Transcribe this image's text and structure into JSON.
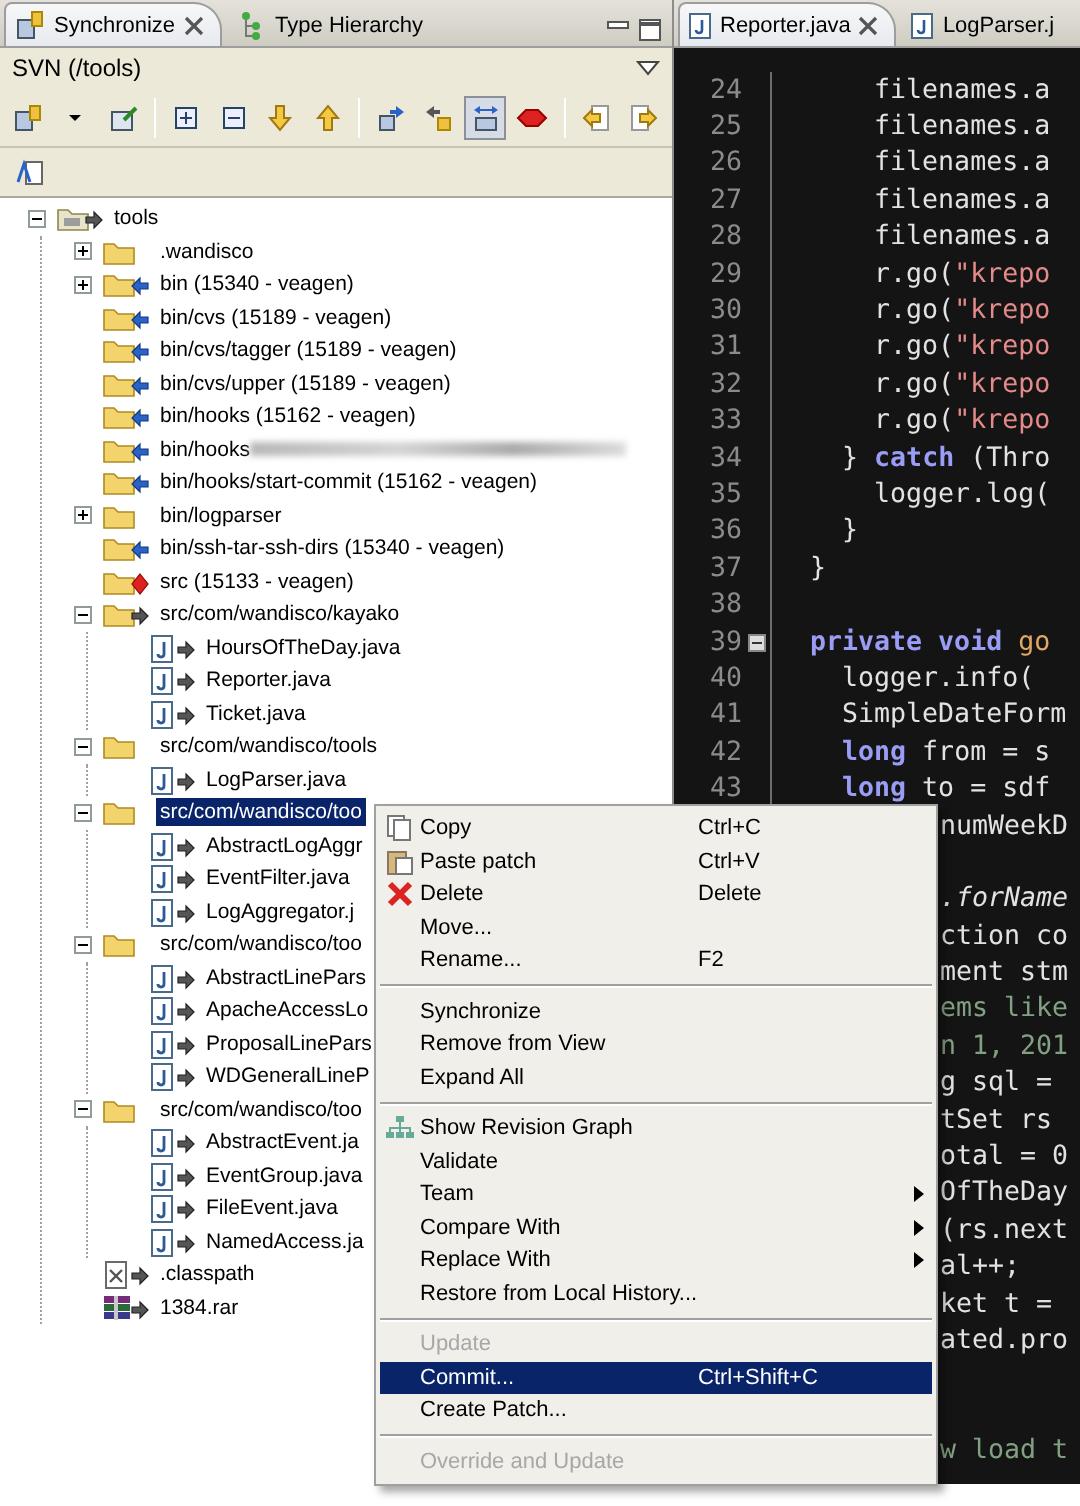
{
  "view_tabs": [
    {
      "label": "Synchronize",
      "selected": true
    },
    {
      "label": "Type Hierarchy",
      "selected": false
    }
  ],
  "view_title": "SVN (/tools)",
  "toolbar": [
    {
      "kind": "synchronize",
      "pressed": false
    },
    {
      "kind": "dropdown",
      "pressed": false
    },
    {
      "kind": "commit",
      "pressed": false
    },
    {
      "kind": "separator"
    },
    {
      "kind": "expand",
      "pressed": false
    },
    {
      "kind": "collapse",
      "pressed": false
    },
    {
      "kind": "next",
      "pressed": false
    },
    {
      "kind": "previous",
      "pressed": false
    },
    {
      "kind": "separator"
    },
    {
      "kind": "incoming",
      "pressed": false
    },
    {
      "kind": "outgoing",
      "pressed": false
    },
    {
      "kind": "both",
      "pressed": true
    },
    {
      "kind": "conflicts",
      "pressed": false
    },
    {
      "kind": "separator"
    },
    {
      "kind": "back",
      "pressed": false
    },
    {
      "kind": "forward",
      "pressed": false
    }
  ],
  "toolbar_2": [
    {
      "kind": "sort",
      "pressed": false
    }
  ],
  "tree": [
    {
      "label": "tools",
      "kind": "project",
      "incoming": false,
      "outgoing": true,
      "conflict": false,
      "selected": false,
      "expanded": true,
      "children": [
        {
          "label": ".wandisco",
          "kind": "folder",
          "incoming": false,
          "outgoing": false,
          "conflict": false,
          "selected": false,
          "expanded": false
        },
        {
          "label": "bin (15340 - veagen)",
          "kind": "folder",
          "incoming": true,
          "outgoing": false,
          "conflict": false,
          "selected": false,
          "expanded": false
        },
        {
          "label": "bin/cvs (15189 - veagen)",
          "kind": "folder",
          "incoming": true,
          "outgoing": false,
          "conflict": false,
          "selected": false
        },
        {
          "label": "bin/cvs/tagger (15189 - veagen)",
          "kind": "folder",
          "incoming": true,
          "outgoing": false,
          "conflict": false,
          "selected": false
        },
        {
          "label": "bin/cvs/upper (15189 - veagen)",
          "kind": "folder",
          "incoming": true,
          "outgoing": false,
          "conflict": false,
          "selected": false
        },
        {
          "label": "bin/hooks (15162 - veagen)",
          "kind": "folder",
          "incoming": true,
          "outgoing": false,
          "conflict": false,
          "selected": false
        },
        {
          "label": "bin/hooks",
          "kind": "folder",
          "incoming": true,
          "outgoing": false,
          "conflict": false,
          "selected": false,
          "redacted": true
        },
        {
          "label": "bin/hooks/start-commit (15162 - veagen)",
          "kind": "folder",
          "incoming": true,
          "outgoing": false,
          "conflict": false,
          "selected": false
        },
        {
          "label": "bin/logparser",
          "kind": "folder",
          "incoming": false,
          "outgoing": false,
          "conflict": false,
          "selected": false,
          "expanded": false
        },
        {
          "label": "bin/ssh-tar-ssh-dirs (15340 - veagen)",
          "kind": "folder",
          "incoming": true,
          "outgoing": false,
          "conflict": false,
          "selected": false
        },
        {
          "label": "src (15133 - veagen)",
          "kind": "folder",
          "incoming": false,
          "outgoing": false,
          "conflict": true,
          "selected": false
        },
        {
          "label": "src/com/wandisco/kayako",
          "kind": "folder",
          "incoming": false,
          "outgoing": true,
          "conflict": false,
          "selected": false,
          "expanded": true,
          "children": [
            {
              "label": "HoursOfTheDay.java",
              "kind": "java",
              "incoming": false,
              "outgoing": true,
              "conflict": false,
              "selected": false
            },
            {
              "label": "Reporter.java",
              "kind": "java",
              "incoming": false,
              "outgoing": true,
              "conflict": false,
              "selected": false
            },
            {
              "label": "Ticket.java",
              "kind": "java",
              "incoming": false,
              "outgoing": true,
              "conflict": false,
              "selected": false
            }
          ]
        },
        {
          "label": "src/com/wandisco/tools",
          "kind": "folder",
          "incoming": false,
          "outgoing": false,
          "conflict": false,
          "selected": false,
          "expanded": true,
          "children": [
            {
              "label": "LogParser.java",
              "kind": "java",
              "incoming": false,
              "outgoing": true,
              "conflict": false,
              "selected": false
            }
          ]
        },
        {
          "label": "src/com/wandisco/too",
          "kind": "folder",
          "incoming": false,
          "outgoing": false,
          "conflict": false,
          "selected": true,
          "expanded": true,
          "children": [
            {
              "label": "AbstractLogAggr",
              "kind": "java",
              "incoming": false,
              "outgoing": true,
              "conflict": false,
              "selected": false
            },
            {
              "label": "EventFilter.java",
              "kind": "java",
              "incoming": false,
              "outgoing": true,
              "conflict": false,
              "selected": false
            },
            {
              "label": "LogAggregator.j",
              "kind": "java",
              "incoming": false,
              "outgoing": true,
              "conflict": false,
              "selected": false
            }
          ]
        },
        {
          "label": "src/com/wandisco/too",
          "kind": "folder",
          "incoming": false,
          "outgoing": false,
          "conflict": false,
          "selected": false,
          "expanded": true,
          "children": [
            {
              "label": "AbstractLinePars",
              "kind": "java",
              "incoming": false,
              "outgoing": true,
              "conflict": false,
              "selected": false
            },
            {
              "label": "ApacheAccessLo",
              "kind": "java",
              "incoming": false,
              "outgoing": true,
              "conflict": false,
              "selected": false
            },
            {
              "label": "ProposalLinePars",
              "kind": "java",
              "incoming": false,
              "outgoing": true,
              "conflict": false,
              "selected": false
            },
            {
              "label": "WDGeneralLineP",
              "kind": "java",
              "incoming": false,
              "outgoing": true,
              "conflict": false,
              "selected": false
            }
          ]
        },
        {
          "label": "src/com/wandisco/too",
          "kind": "folder",
          "incoming": false,
          "outgoing": false,
          "conflict": false,
          "selected": false,
          "expanded": true,
          "children": [
            {
              "label": "AbstractEvent.ja",
              "kind": "java",
              "incoming": false,
              "outgoing": true,
              "conflict": false,
              "selected": false
            },
            {
              "label": "EventGroup.java",
              "kind": "java",
              "incoming": false,
              "outgoing": true,
              "conflict": false,
              "selected": false
            },
            {
              "label": "FileEvent.java",
              "kind": "java",
              "incoming": false,
              "outgoing": true,
              "conflict": false,
              "selected": false
            },
            {
              "label": "NamedAccess.ja",
              "kind": "java",
              "incoming": false,
              "outgoing": true,
              "conflict": false,
              "selected": false
            }
          ]
        },
        {
          "label": ".classpath",
          "kind": "xml",
          "incoming": false,
          "outgoing": true,
          "conflict": false,
          "selected": false
        },
        {
          "label": "1384.rar",
          "kind": "archive",
          "incoming": false,
          "outgoing": true,
          "conflict": false,
          "selected": false
        }
      ]
    }
  ],
  "editor_tabs": [
    {
      "label": "Reporter.java",
      "selected": true
    },
    {
      "label": "LogParser.j",
      "selected": false
    }
  ],
  "code_lines": [
    {
      "number": "24",
      "kind": "normal",
      "tokens": [
        {
          "text": "      filenames.a",
          "kind": "plain"
        }
      ]
    },
    {
      "number": "25",
      "kind": "normal",
      "tokens": [
        {
          "text": "      filenames.a",
          "kind": "plain"
        }
      ]
    },
    {
      "number": "26",
      "kind": "normal",
      "tokens": [
        {
          "text": "      filenames.a",
          "kind": "plain"
        }
      ]
    },
    {
      "number": "27",
      "kind": "normal",
      "tokens": [
        {
          "text": "      filenames.a",
          "kind": "plain"
        }
      ]
    },
    {
      "number": "28",
      "kind": "normal",
      "tokens": [
        {
          "text": "      filenames.a",
          "kind": "plain"
        }
      ]
    },
    {
      "number": "29",
      "kind": "normal",
      "tokens": [
        {
          "text": "      r.go(",
          "kind": "plain"
        },
        {
          "text": "\"krepo",
          "kind": "string"
        }
      ]
    },
    {
      "number": "30",
      "kind": "normal",
      "tokens": [
        {
          "text": "      r.go(",
          "kind": "plain"
        },
        {
          "text": "\"krepo",
          "kind": "string"
        }
      ]
    },
    {
      "number": "31",
      "kind": "normal",
      "tokens": [
        {
          "text": "      r.go(",
          "kind": "plain"
        },
        {
          "text": "\"krepo",
          "kind": "string"
        }
      ]
    },
    {
      "number": "32",
      "kind": "normal",
      "tokens": [
        {
          "text": "      r.go(",
          "kind": "plain"
        },
        {
          "text": "\"krepo",
          "kind": "string"
        }
      ]
    },
    {
      "number": "33",
      "kind": "normal",
      "tokens": [
        {
          "text": "      r.go(",
          "kind": "plain"
        },
        {
          "text": "\"krepo",
          "kind": "string"
        }
      ]
    },
    {
      "number": "34",
      "kind": "normal",
      "tokens": [
        {
          "text": "    } ",
          "kind": "plain"
        },
        {
          "text": "catch",
          "kind": "keyword"
        },
        {
          "text": " (Thro",
          "kind": "plain"
        }
      ]
    },
    {
      "number": "35",
      "kind": "normal",
      "tokens": [
        {
          "text": "      logger.log(",
          "kind": "plain"
        }
      ]
    },
    {
      "number": "36",
      "kind": "normal",
      "tokens": [
        {
          "text": "    }",
          "kind": "plain"
        }
      ]
    },
    {
      "number": "37",
      "kind": "normal",
      "tokens": [
        {
          "text": "  }",
          "kind": "plain"
        }
      ]
    },
    {
      "number": "38"
    },
    {
      "number": "39",
      "kind": "normal",
      "fold_marker": true,
      "tokens": [
        {
          "text": "  private void",
          "kind": "keyword"
        },
        {
          "text": " go",
          "kind": "method"
        }
      ]
    },
    {
      "number": "40",
      "kind": "normal",
      "tokens": [
        {
          "text": "    logger.info(",
          "kind": "plain"
        }
      ]
    },
    {
      "number": "41",
      "kind": "normal",
      "tokens": [
        {
          "text": "    SimpleDateForm",
          "kind": "plain"
        }
      ]
    },
    {
      "number": "42",
      "kind": "normal",
      "tokens": [
        {
          "text": "    long",
          "kind": "keyword"
        },
        {
          "text": " from = s",
          "kind": "plain"
        }
      ]
    },
    {
      "number": "43",
      "kind": "normal",
      "tokens": [
        {
          "text": "    long",
          "kind": "keyword"
        },
        {
          "text": " to = sdf",
          "kind": "plain"
        }
      ]
    },
    {
      "kind": "clipped",
      "tokens": [
        {
          "text": "numWeekD",
          "kind": "plain"
        }
      ]
    },
    {
      "kind": "blank"
    },
    {
      "kind": "clipped",
      "tokens": [
        {
          "text": ".forName",
          "kind": "italic"
        }
      ]
    },
    {
      "kind": "clipped",
      "tokens": [
        {
          "text": "ction co",
          "kind": "plain"
        }
      ]
    },
    {
      "kind": "clipped",
      "tokens": [
        {
          "text": "ment stm",
          "kind": "plain"
        }
      ]
    },
    {
      "kind": "clipped",
      "tokens": [
        {
          "text": "ems like",
          "kind": "comment"
        }
      ]
    },
    {
      "kind": "clipped",
      "tokens": [
        {
          "text": "n 1, 201",
          "kind": "comment"
        }
      ]
    },
    {
      "kind": "clipped",
      "tokens": [
        {
          "text": "g sql =",
          "kind": "plain"
        }
      ]
    },
    {
      "kind": "clipped",
      "tokens": [
        {
          "text": "tSet rs",
          "kind": "plain"
        }
      ]
    },
    {
      "kind": "clipped",
      "tokens": [
        {
          "text": "otal = 0",
          "kind": "plain"
        }
      ]
    },
    {
      "kind": "clipped",
      "tokens": [
        {
          "text": "OfTheDay",
          "kind": "plain"
        }
      ]
    },
    {
      "kind": "clipped",
      "tokens": [
        {
          "text": "(rs.next",
          "kind": "plain"
        }
      ]
    },
    {
      "kind": "clipped",
      "tokens": [
        {
          "text": "al++;",
          "kind": "plain"
        }
      ]
    },
    {
      "kind": "clipped",
      "tokens": [
        {
          "text": "ket t =",
          "kind": "plain"
        }
      ]
    },
    {
      "kind": "clipped",
      "tokens": [
        {
          "text": "ated.pro",
          "kind": "plain"
        }
      ]
    },
    {
      "kind": "blank"
    },
    {
      "kind": "blank"
    },
    {
      "kind": "clipped",
      "tokens": [
        {
          "text": "w load t",
          "kind": "comment"
        }
      ]
    }
  ],
  "context_menu": [
    {
      "kind": "copy",
      "label": "Copy",
      "shortcut": "Ctrl+C",
      "selected": false,
      "disabled": false
    },
    {
      "kind": "paste",
      "label": "Paste patch",
      "shortcut": "Ctrl+V",
      "selected": false,
      "disabled": false
    },
    {
      "kind": "delete",
      "label": "Delete",
      "shortcut": "Delete",
      "selected": false,
      "disabled": false
    },
    {
      "kind": "plain",
      "label": "Move...",
      "selected": false,
      "disabled": false
    },
    {
      "kind": "plain",
      "label": "Rename...",
      "shortcut": "F2",
      "selected": false,
      "disabled": false
    },
    {
      "kind": "separator"
    },
    {
      "kind": "plain",
      "label": "Synchronize",
      "selected": false,
      "disabled": false
    },
    {
      "kind": "plain",
      "label": "Remove from View",
      "selected": false,
      "disabled": false
    },
    {
      "kind": "plain",
      "label": "Expand All",
      "selected": false,
      "disabled": false
    },
    {
      "kind": "separator"
    },
    {
      "kind": "graph",
      "label": "Show Revision Graph",
      "selected": false,
      "disabled": false
    },
    {
      "kind": "plain",
      "label": "Validate",
      "selected": false,
      "disabled": false
    },
    {
      "kind": "plain",
      "label": "Team",
      "submenu": true,
      "selected": false,
      "disabled": false
    },
    {
      "kind": "plain",
      "label": "Compare With",
      "submenu": true,
      "selected": false,
      "disabled": false
    },
    {
      "kind": "plain",
      "label": "Replace With",
      "submenu": true,
      "selected": false,
      "disabled": false
    },
    {
      "kind": "plain",
      "label": "Restore from Local History...",
      "selected": false,
      "disabled": false
    },
    {
      "kind": "separator"
    },
    {
      "kind": "plain",
      "label": "Update",
      "selected": false,
      "disabled": true
    },
    {
      "kind": "plain",
      "label": "Commit...",
      "shortcut": "Ctrl+Shift+C",
      "selected": true,
      "disabled": false
    },
    {
      "kind": "plain",
      "label": "Create Patch...",
      "selected": false,
      "disabled": false
    },
    {
      "kind": "separator"
    },
    {
      "kind": "plain",
      "label": "Override and Update",
      "selected": false,
      "disabled": true
    }
  ]
}
